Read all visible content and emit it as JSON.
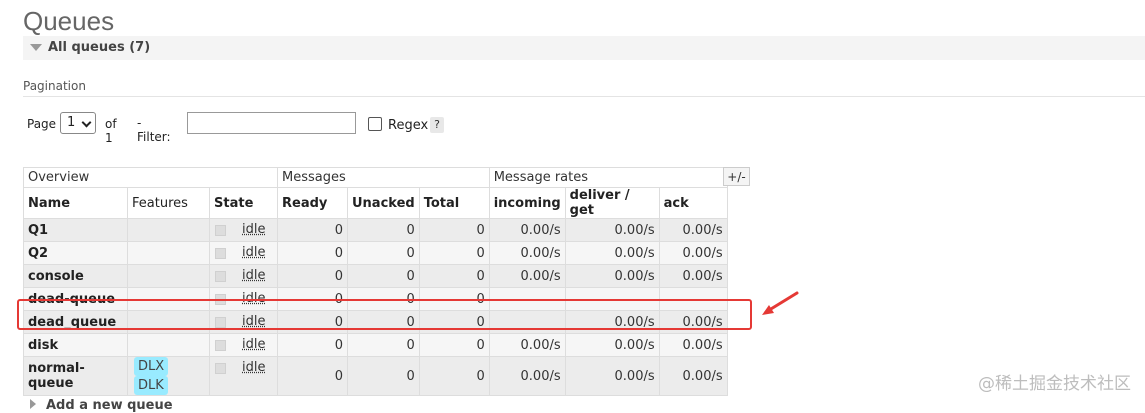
{
  "page_title": "Queues",
  "section": {
    "label": "All queues (7)"
  },
  "pagination": {
    "label": "Pagination",
    "page_label": "Page",
    "page_value": "1",
    "of_label": "of 1",
    "filter_label": "- Filter:",
    "filter_value": "",
    "regex_label": "Regex",
    "help_label": "?"
  },
  "table": {
    "groups": [
      "Overview",
      "Messages",
      "Message rates"
    ],
    "columns": [
      "Name",
      "Features",
      "State",
      "Ready",
      "Unacked",
      "Total",
      "incoming",
      "deliver / get",
      "ack"
    ],
    "plus_minus": "+/-",
    "rows": [
      {
        "name": "Q1",
        "features": [],
        "state": "idle",
        "ready": "0",
        "unacked": "0",
        "total": "0",
        "incoming": "0.00/s",
        "deliver_get": "0.00/s",
        "ack": "0.00/s"
      },
      {
        "name": "Q2",
        "features": [],
        "state": "idle",
        "ready": "0",
        "unacked": "0",
        "total": "0",
        "incoming": "0.00/s",
        "deliver_get": "0.00/s",
        "ack": "0.00/s"
      },
      {
        "name": "console",
        "features": [],
        "state": "idle",
        "ready": "0",
        "unacked": "0",
        "total": "0",
        "incoming": "0.00/s",
        "deliver_get": "0.00/s",
        "ack": "0.00/s"
      },
      {
        "name": "dead-queue",
        "features": [],
        "state": "idle",
        "ready": "0",
        "unacked": "0",
        "total": "0",
        "incoming": "",
        "deliver_get": "",
        "ack": ""
      },
      {
        "name": "dead_queue",
        "features": [],
        "state": "idle",
        "ready": "0",
        "unacked": "0",
        "total": "0",
        "incoming": "",
        "deliver_get": "0.00/s",
        "ack": "0.00/s"
      },
      {
        "name": "disk",
        "features": [],
        "state": "idle",
        "ready": "0",
        "unacked": "0",
        "total": "0",
        "incoming": "0.00/s",
        "deliver_get": "0.00/s",
        "ack": "0.00/s"
      },
      {
        "name": "normal-queue",
        "features": [
          "DLX",
          "DLK"
        ],
        "state": "idle",
        "ready": "0",
        "unacked": "0",
        "total": "0",
        "incoming": "0.00/s",
        "deliver_get": "0.00/s",
        "ack": "0.00/s"
      }
    ]
  },
  "add_queue_label": "Add a new queue",
  "watermark": "@稀土掘金技术社区",
  "colors": {
    "highlight": "#e53935",
    "badge": "#99ebff"
  }
}
